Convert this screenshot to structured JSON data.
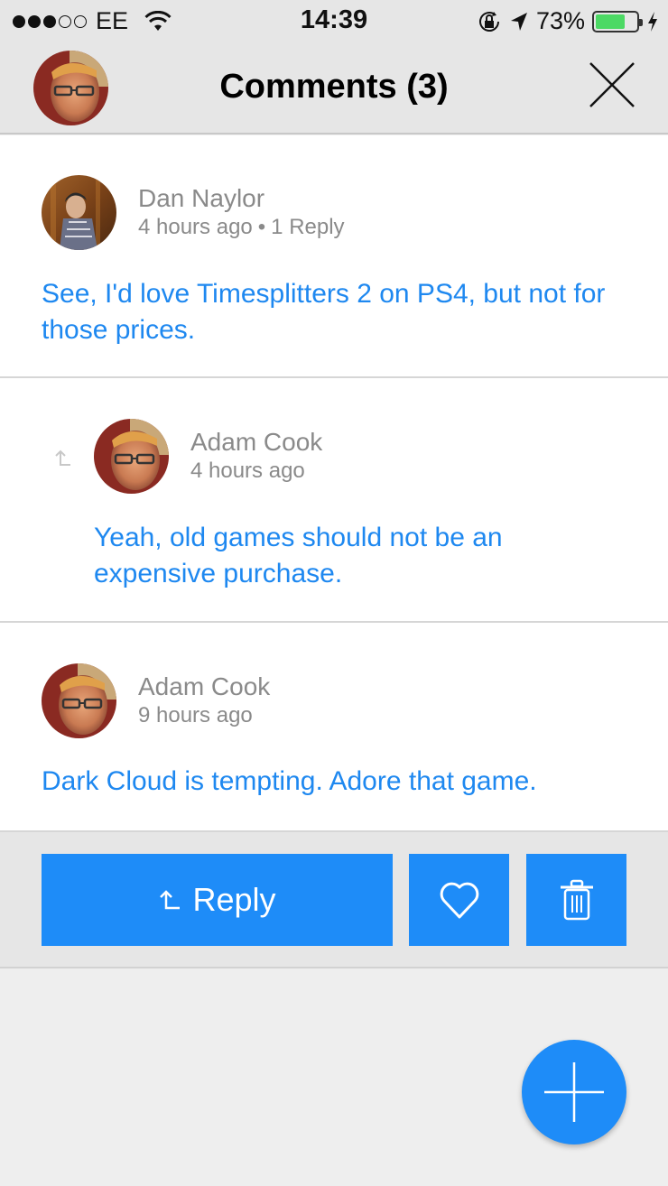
{
  "status_bar": {
    "signal_strength": 3,
    "signal_max": 5,
    "carrier": "EE",
    "time": "14:39",
    "battery_percent": "73%",
    "battery_level": 0.73,
    "icons": [
      "wifi-icon",
      "rotation-lock-icon",
      "location-arrow-icon",
      "battery-icon",
      "charging-bolt-icon"
    ]
  },
  "header": {
    "title": "Comments (3)",
    "avatar_alt": "Adam Cook",
    "close_icon": "close-icon"
  },
  "comments": [
    {
      "author": "Dan Naylor",
      "time": "4 hours ago",
      "replies": "1 Reply",
      "body": "See, I'd love Timesplitters 2 on PS4, but not for those prices.",
      "is_reply": false
    },
    {
      "author": "Adam Cook",
      "time": "4 hours ago",
      "replies": "",
      "body": "Yeah, old games should not be an expensive purchase.",
      "is_reply": true
    },
    {
      "author": "Adam Cook",
      "time": "9 hours ago",
      "replies": "",
      "body": "Dark Cloud is tempting. Adore that game.",
      "is_reply": false
    }
  ],
  "actions": {
    "reply_label": "Reply",
    "like_icon": "heart-icon",
    "delete_icon": "trash-icon",
    "add_icon": "plus-icon"
  },
  "colors": {
    "accent": "#1e8cf8",
    "comment_text": "#1e88f0",
    "meta_text": "#8a8a8a",
    "bar_bg": "#e6e6e6",
    "battery_green": "#4cd964"
  }
}
